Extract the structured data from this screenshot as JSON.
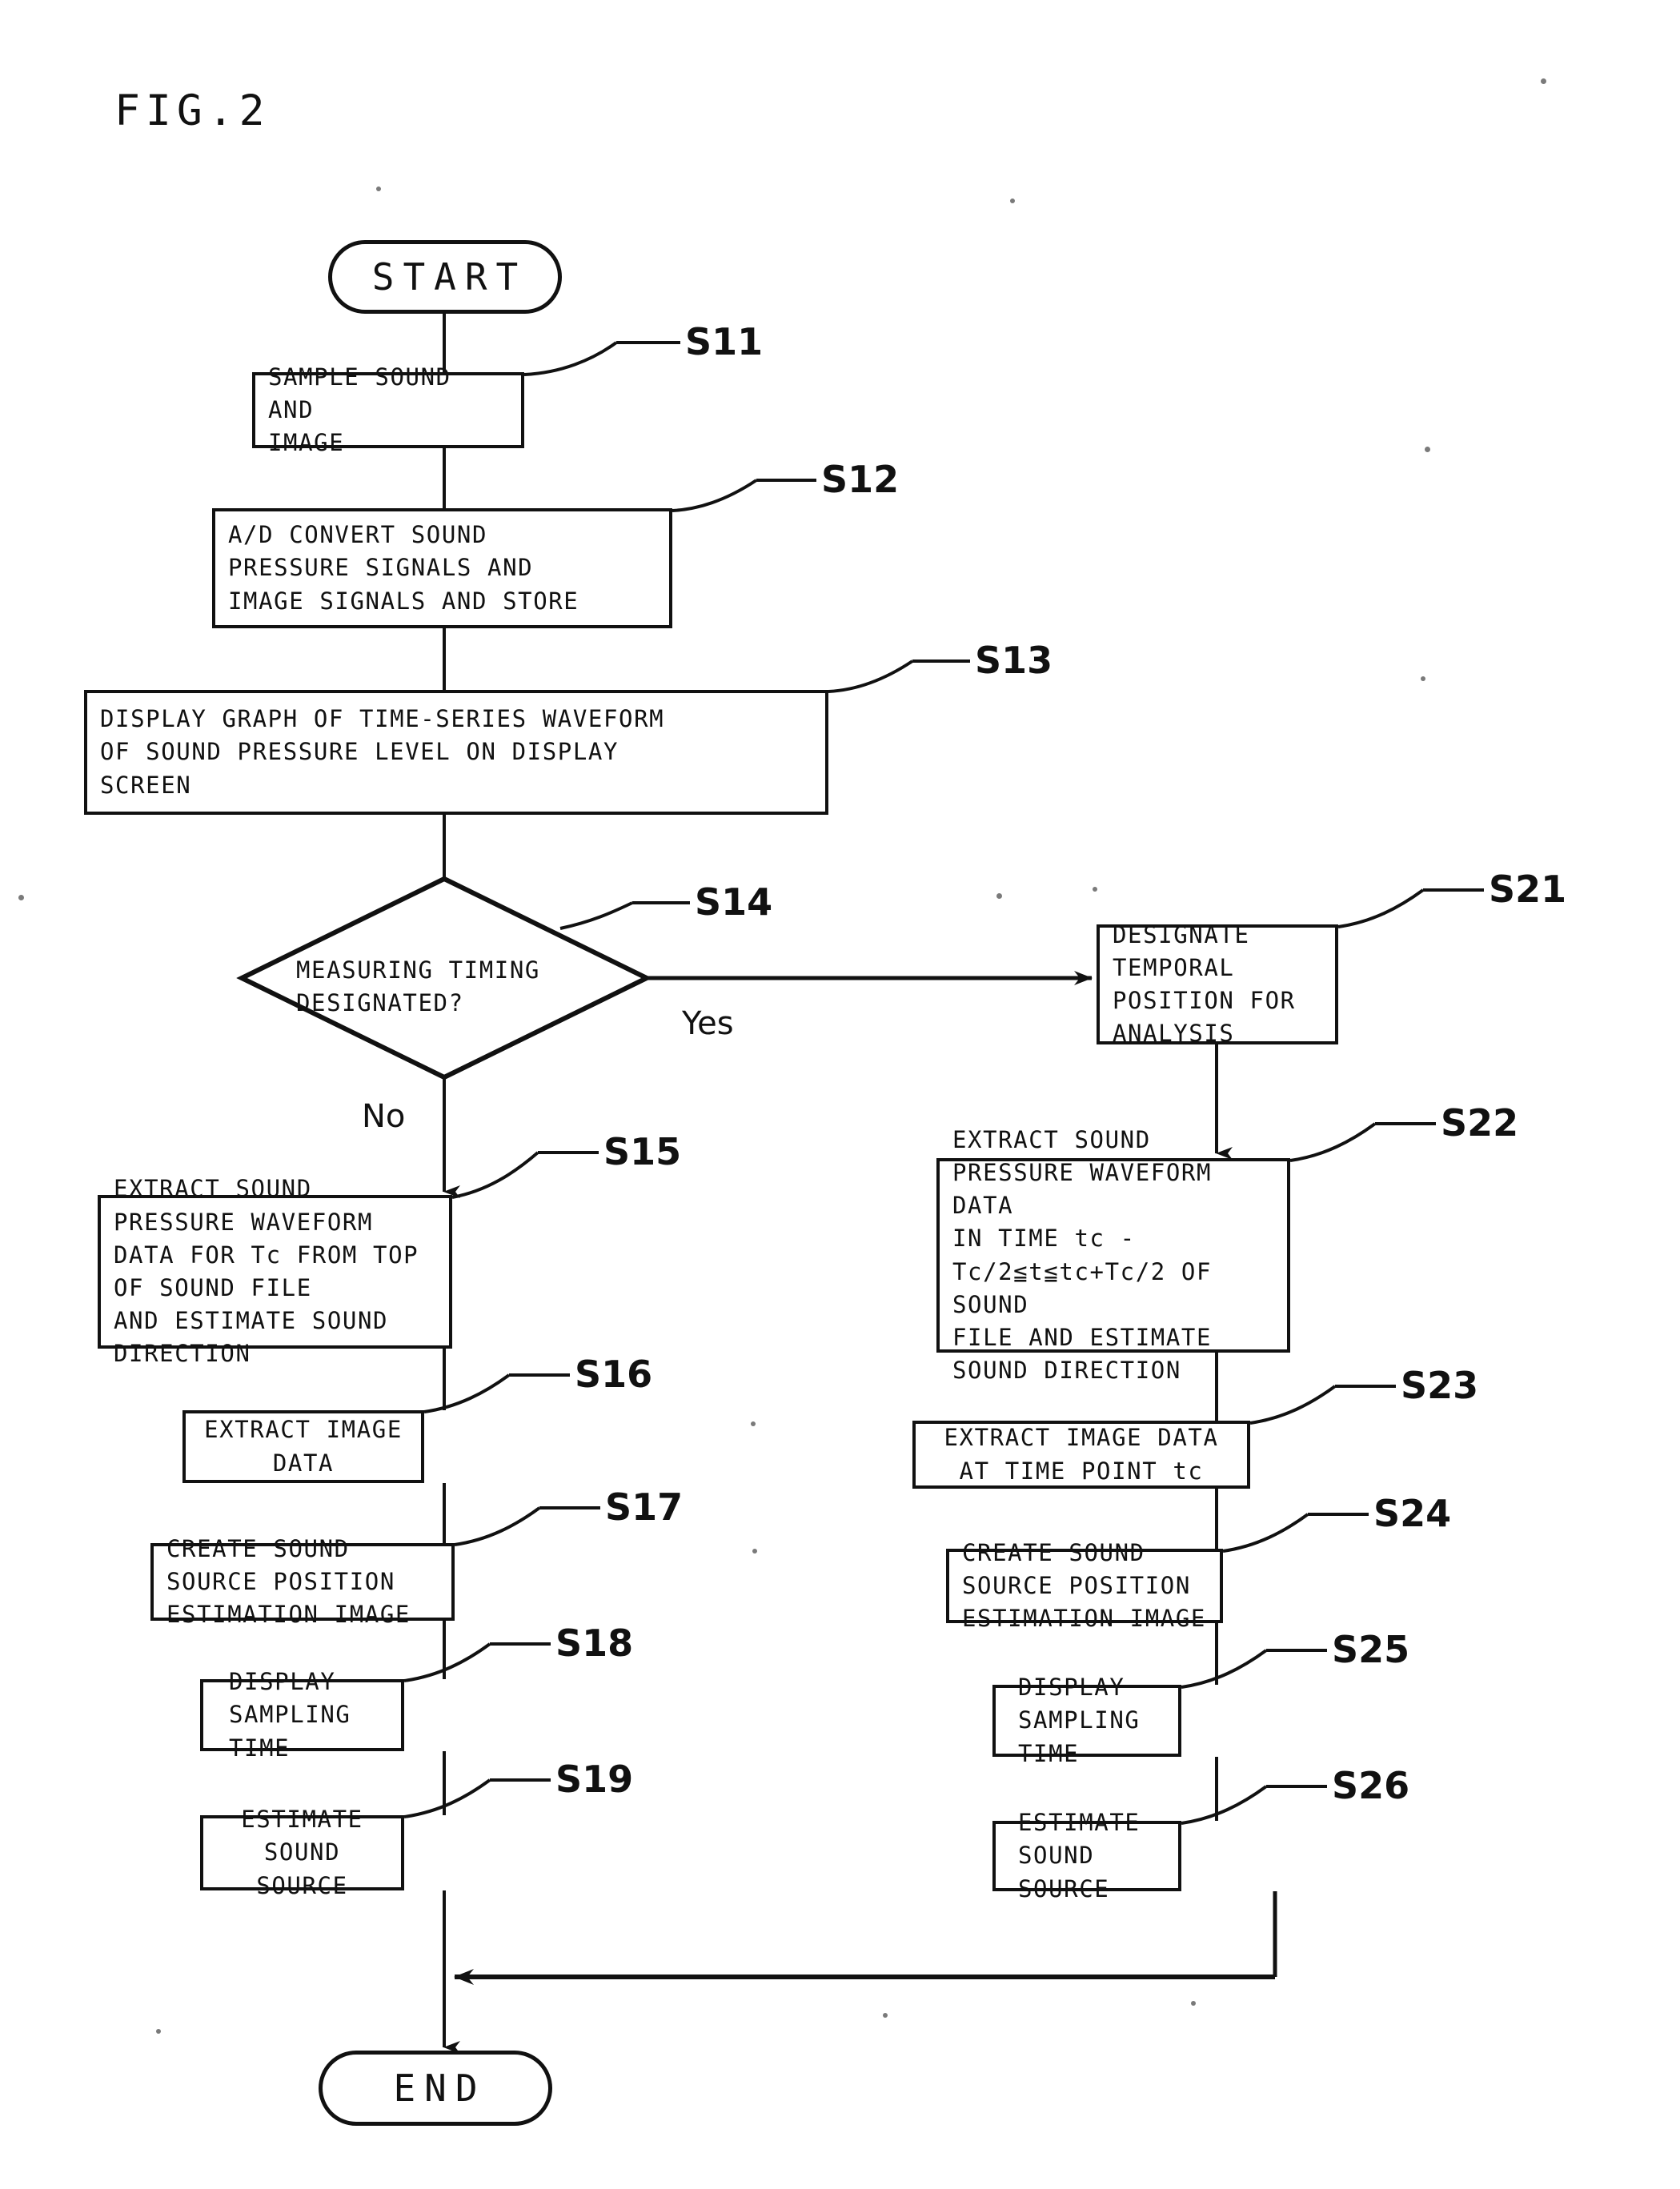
{
  "figure": {
    "caption": "FIG.2"
  },
  "terminals": {
    "start": "START",
    "end": "END"
  },
  "branch_labels": {
    "yes": "Yes",
    "no": "No"
  },
  "decision": {
    "id": "S14",
    "text": "MEASURING TIMING\nDESIGNATED?"
  },
  "left_branch": [
    {
      "id": "S11",
      "text": "SAMPLE SOUND AND\nIMAGE"
    },
    {
      "id": "S12",
      "text": "A/D CONVERT SOUND\nPRESSURE SIGNALS AND\nIMAGE SIGNALS AND STORE"
    },
    {
      "id": "S13",
      "text": "DISPLAY GRAPH OF TIME-SERIES WAVEFORM\nOF SOUND PRESSURE LEVEL ON DISPLAY\nSCREEN"
    },
    {
      "id": "S15",
      "text": "EXTRACT SOUND PRESSURE WAVEFORM\nDATA FOR Tc FROM TOP OF SOUND FILE\nAND ESTIMATE SOUND DIRECTION"
    },
    {
      "id": "S16",
      "text": "EXTRACT IMAGE DATA"
    },
    {
      "id": "S17",
      "text": "CREATE SOUND SOURCE POSITION\nESTIMATION IMAGE"
    },
    {
      "id": "S18",
      "text": "DISPLAY SAMPLING\nTIME"
    },
    {
      "id": "S19",
      "text": "ESTIMATE SOUND SOURCE"
    }
  ],
  "right_branch": [
    {
      "id": "S21",
      "text": "DESIGNATE TEMPORAL\nPOSITION FOR\nANALYSIS"
    },
    {
      "id": "S22",
      "text": "EXTRACT SOUND PRESSURE WAVEFORM DATA\nIN TIME tc -Tc/2≦t≦tc+Tc/2 OF SOUND\nFILE AND ESTIMATE SOUND DIRECTION"
    },
    {
      "id": "S23",
      "text": "EXTRACT IMAGE DATA AT TIME POINT tc"
    },
    {
      "id": "S24",
      "text": "CREATE SOUND SOURCE POSITION\nESTIMATION IMAGE"
    },
    {
      "id": "S25",
      "text": "DISPLAY SAMPLING\nTIME"
    },
    {
      "id": "S26",
      "text": "ESTIMATE SOUND\nSOURCE"
    }
  ],
  "colors": {
    "ink": "#111111",
    "paper": "#ffffff"
  }
}
